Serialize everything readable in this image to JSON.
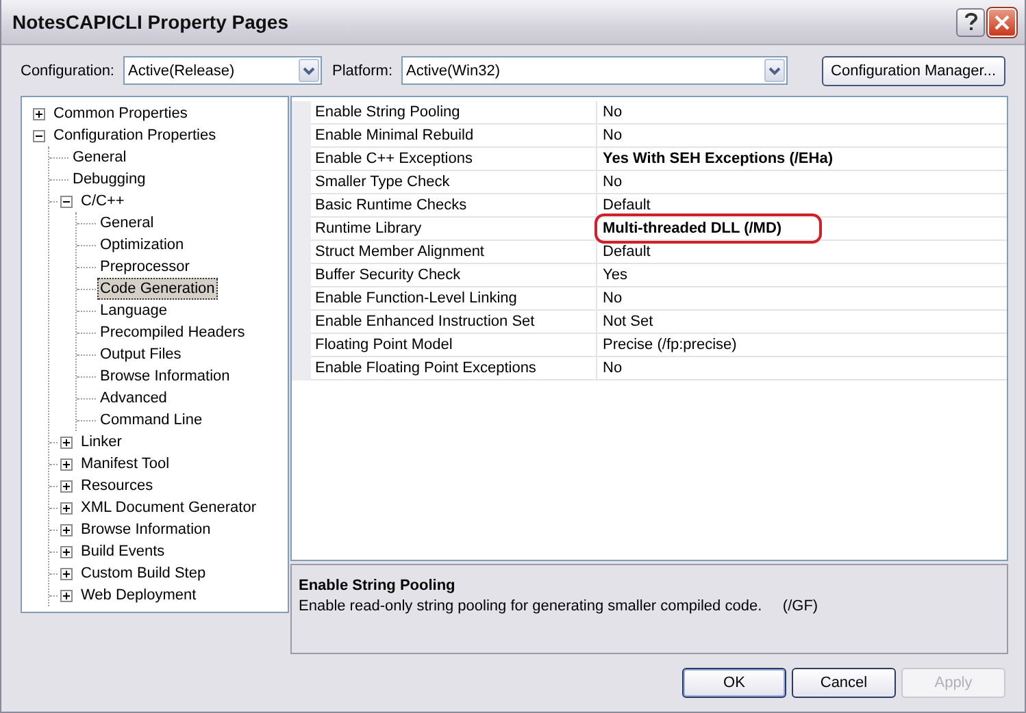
{
  "window": {
    "title": "NotesCAPICLI Property Pages"
  },
  "configuration": {
    "label": "Configuration:",
    "value": "Active(Release)"
  },
  "platform": {
    "label": "Platform:",
    "value": "Active(Win32)"
  },
  "configuration_manager_button": "Configuration Manager...",
  "tree": [
    {
      "label": "Common Properties",
      "expanded": false,
      "selected": false
    },
    {
      "label": "Configuration Properties",
      "expanded": true,
      "selected": false,
      "children": [
        {
          "label": "General",
          "selected": false
        },
        {
          "label": "Debugging",
          "selected": false
        },
        {
          "label": "C/C++",
          "expanded": true,
          "selected": false,
          "children": [
            {
              "label": "General",
              "selected": false
            },
            {
              "label": "Optimization",
              "selected": false
            },
            {
              "label": "Preprocessor",
              "selected": false
            },
            {
              "label": "Code Generation",
              "selected": true
            },
            {
              "label": "Language",
              "selected": false
            },
            {
              "label": "Precompiled Headers",
              "selected": false
            },
            {
              "label": "Output Files",
              "selected": false
            },
            {
              "label": "Browse Information",
              "selected": false
            },
            {
              "label": "Advanced",
              "selected": false
            },
            {
              "label": "Command Line",
              "selected": false
            }
          ]
        },
        {
          "label": "Linker",
          "expanded": false,
          "selected": false
        },
        {
          "label": "Manifest Tool",
          "expanded": false,
          "selected": false
        },
        {
          "label": "Resources",
          "expanded": false,
          "selected": false
        },
        {
          "label": "XML Document Generator",
          "expanded": false,
          "selected": false
        },
        {
          "label": "Browse Information",
          "expanded": false,
          "selected": false
        },
        {
          "label": "Build Events",
          "expanded": false,
          "selected": false
        },
        {
          "label": "Custom Build Step",
          "expanded": false,
          "selected": false
        },
        {
          "label": "Web Deployment",
          "expanded": false,
          "selected": false
        }
      ]
    }
  ],
  "properties": [
    {
      "name": "Enable String Pooling",
      "value": "No",
      "bold": false,
      "circled": false
    },
    {
      "name": "Enable Minimal Rebuild",
      "value": "No",
      "bold": false,
      "circled": false
    },
    {
      "name": "Enable C++ Exceptions",
      "value": "Yes With SEH Exceptions (/EHa)",
      "bold": true,
      "circled": false
    },
    {
      "name": "Smaller Type Check",
      "value": "No",
      "bold": false,
      "circled": false
    },
    {
      "name": "Basic Runtime Checks",
      "value": "Default",
      "bold": false,
      "circled": false
    },
    {
      "name": "Runtime Library",
      "value": "Multi-threaded DLL (/MD)",
      "bold": true,
      "circled": true
    },
    {
      "name": "Struct Member Alignment",
      "value": "Default",
      "bold": false,
      "circled": false
    },
    {
      "name": "Buffer Security Check",
      "value": "Yes",
      "bold": false,
      "circled": false
    },
    {
      "name": "Enable Function-Level Linking",
      "value": "No",
      "bold": false,
      "circled": false
    },
    {
      "name": "Enable Enhanced Instruction Set",
      "value": "Not Set",
      "bold": false,
      "circled": false
    },
    {
      "name": "Floating Point Model",
      "value": "Precise (/fp:precise)",
      "bold": false,
      "circled": false
    },
    {
      "name": "Enable Floating Point Exceptions",
      "value": "No",
      "bold": false,
      "circled": false
    }
  ],
  "description": {
    "title": "Enable String Pooling",
    "text": "Enable read-only string pooling for generating smaller compiled code.     (/GF)"
  },
  "buttons": [
    {
      "label": "OK",
      "disabled": false,
      "default": true
    },
    {
      "label": "Cancel",
      "disabled": false,
      "default": false
    },
    {
      "label": "Apply",
      "disabled": true,
      "default": false
    }
  ]
}
